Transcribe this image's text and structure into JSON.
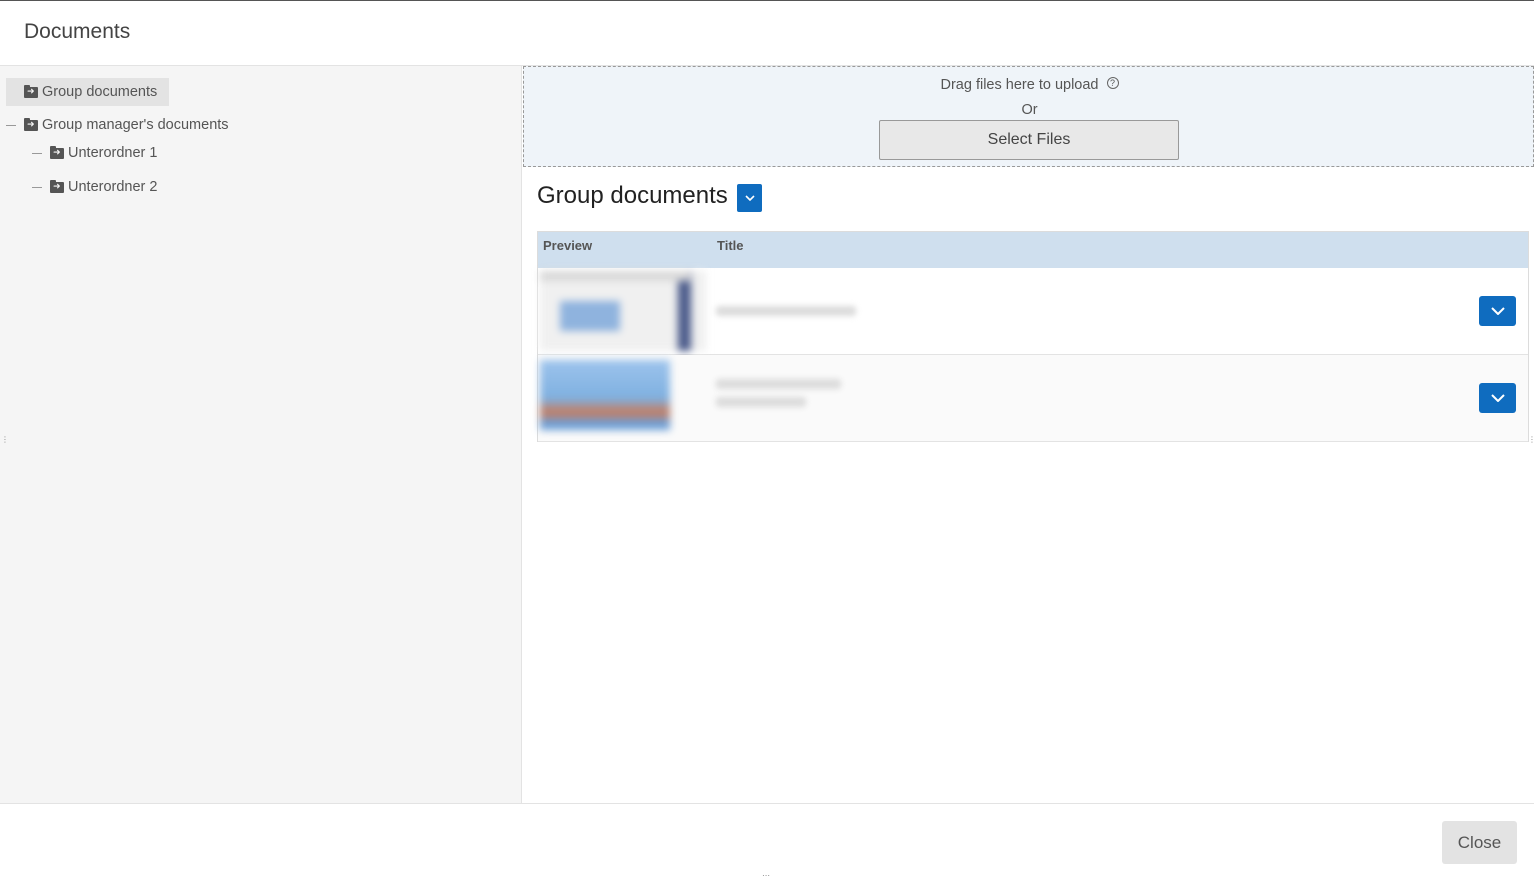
{
  "dialog": {
    "title": "Documents",
    "close_label": "Close"
  },
  "tree": {
    "items": [
      {
        "label": "Group documents",
        "selected": true
      },
      {
        "label": "Group manager's documents",
        "selected": false
      },
      {
        "label": "Unterordner 1",
        "selected": false
      },
      {
        "label": "Unterordner 2",
        "selected": false
      }
    ]
  },
  "upload": {
    "drag_text": "Drag files here to upload",
    "or_text": "Or",
    "select_label": "Select Files",
    "help_glyph": "?"
  },
  "folder": {
    "heading": "Group documents"
  },
  "table": {
    "columns": [
      "Preview",
      "Title"
    ]
  },
  "colors": {
    "primary": "#0f6cbf",
    "table_header": "#cfdfee",
    "dropzone": "#eff4f9",
    "sidebar": "#f5f5f5"
  }
}
